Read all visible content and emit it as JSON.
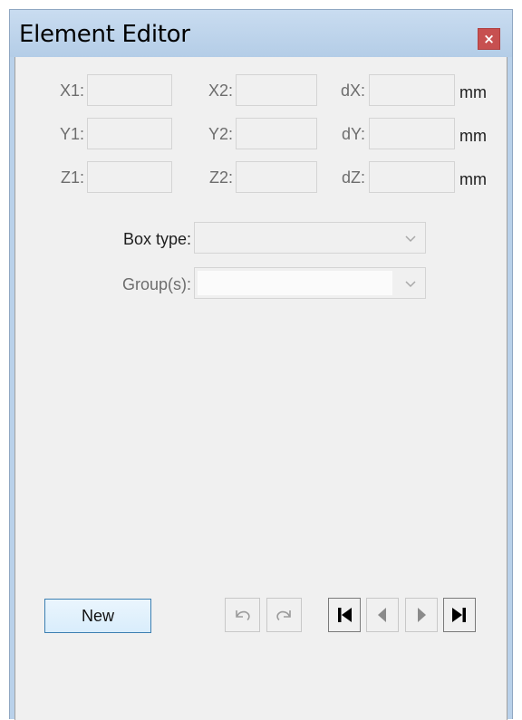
{
  "window": {
    "title": "Element Editor",
    "close_glyph": "×"
  },
  "coords": {
    "row1": {
      "a": "X1:",
      "b": "X2:",
      "c": "dX:",
      "unit": "mm"
    },
    "row2": {
      "a": "Y1:",
      "b": "Y2:",
      "c": "dY:",
      "unit": "mm"
    },
    "row3": {
      "a": "Z1:",
      "b": "Z2:",
      "c": "dZ:",
      "unit": "mm"
    },
    "values": {
      "x1": "",
      "x2": "",
      "dx": "",
      "y1": "",
      "y2": "",
      "dy": "",
      "z1": "",
      "z2": "",
      "dz": ""
    }
  },
  "box_type": {
    "label": "Box type:",
    "selected": ""
  },
  "groups": {
    "label": "Group(s):",
    "selected": ""
  },
  "buttons": {
    "new_label": "New"
  },
  "icons": {
    "undo": "undo-icon",
    "redo": "redo-icon",
    "first": "first-record-icon",
    "prev": "previous-record-icon",
    "next": "next-record-icon",
    "last": "last-record-icon",
    "close": "close-icon",
    "dropdown": "chevron-down-icon"
  },
  "colors": {
    "title_bar": "#b9d1ea",
    "close_button": "#c75050",
    "client_background": "#f0f0f0",
    "new_button_border": "#3c7fb1",
    "disabled_text": "#6d6d6d"
  }
}
